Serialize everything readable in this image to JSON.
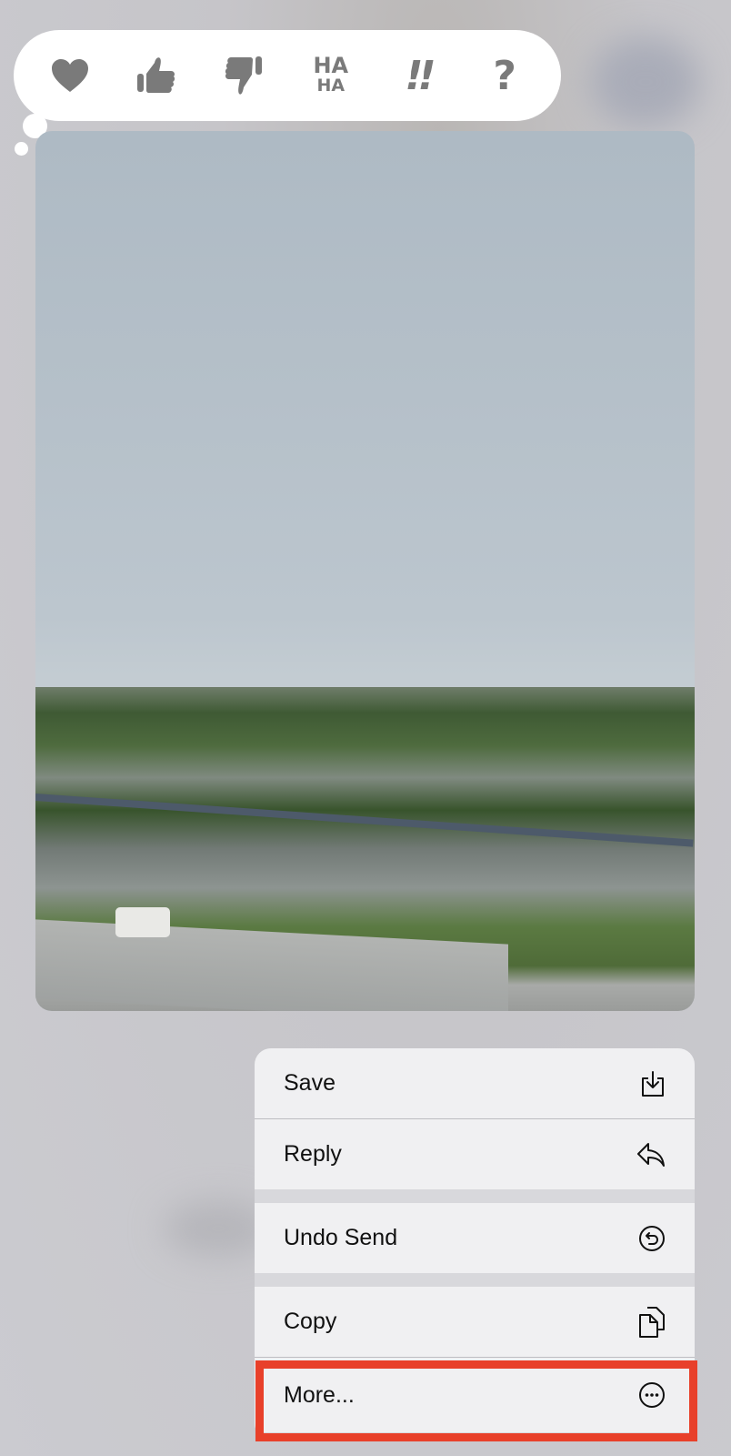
{
  "tapback": {
    "reactions": [
      {
        "name": "heart",
        "icon": "heart-icon"
      },
      {
        "name": "thumbs-up",
        "icon": "thumbs-up-icon"
      },
      {
        "name": "thumbs-down",
        "icon": "thumbs-down-icon"
      },
      {
        "name": "haha",
        "icon": "haha-icon",
        "text_top": "HA",
        "text_bottom": "HA"
      },
      {
        "name": "exclamation",
        "icon": "double-exclamation-icon",
        "text": "!!"
      },
      {
        "name": "question",
        "icon": "question-icon",
        "text": "?"
      }
    ],
    "icon_color": "#7a7a7a"
  },
  "message": {
    "type": "photo",
    "description_icon": "photo"
  },
  "context_menu": {
    "items": [
      {
        "label": "Save",
        "icon": "save-download-icon"
      },
      {
        "label": "Reply",
        "icon": "reply-arrow-icon"
      },
      {
        "label": "Undo Send",
        "icon": "undo-circle-icon"
      },
      {
        "label": "Copy",
        "icon": "copy-docs-icon"
      },
      {
        "label": "More...",
        "icon": "ellipsis-circle-icon"
      }
    ],
    "highlighted_item": "More...",
    "highlight_color": "#e8402a"
  }
}
